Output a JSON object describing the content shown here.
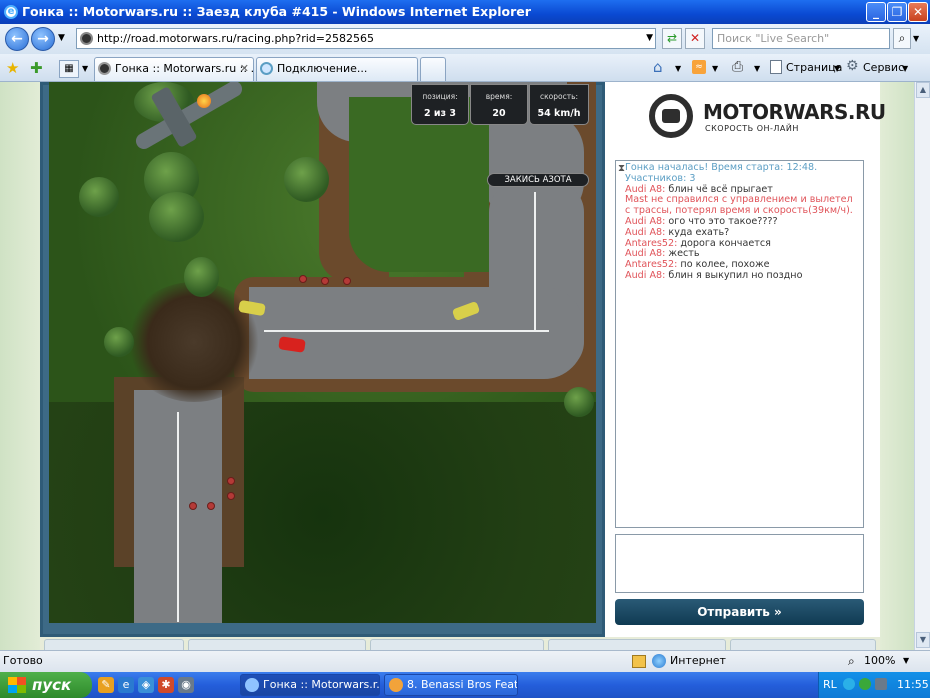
{
  "window": {
    "title": "Гонка :: Motorwars.ru :: Заезд клуба #415 - Windows Internet Explorer",
    "url": "http://road.motorwars.ru/racing.php?rid=2582565",
    "search_placeholder": "Поиск \"Live Search\""
  },
  "tabs": [
    {
      "label": "Гонка :: Motorwars.ru :: ..."
    },
    {
      "label": "Подключение..."
    }
  ],
  "toolbar": {
    "page_label": "Страница",
    "service_label": "Сервис"
  },
  "hud": {
    "position_label": "позиция:",
    "position_value": "2 из 3",
    "time_label": "время:",
    "time_value": "20",
    "speed_label": "скорость:",
    "speed_value": "54 km/h",
    "nitro_label": "ЗАКИСЬ АЗОТА"
  },
  "logo": {
    "name": "MOTORWARS.RU",
    "tagline": "СКОРОСТЬ ОН-ЛАЙН"
  },
  "chat": {
    "messages": [
      {
        "type": "sys",
        "nick": "",
        "text": "Гонка началась! Время старта: 12:48. Участников: 3"
      },
      {
        "type": "msg",
        "nick": "Audi A8:",
        "text": "блин чё всё прыгает"
      },
      {
        "type": "warn",
        "nick": "",
        "text": "Mast не справился с управлением и вылетел с трассы, потерял время и скорость(39км/ч)."
      },
      {
        "type": "msg",
        "nick": "Audi A8:",
        "text": "ого что это такое????"
      },
      {
        "type": "msg",
        "nick": "Audi A8:",
        "text": "куда ехать?"
      },
      {
        "type": "msg",
        "nick": "Antares52:",
        "text": "дорога кончается"
      },
      {
        "type": "msg",
        "nick": "Audi A8:",
        "text": "жесть"
      },
      {
        "type": "msg",
        "nick": "Antares52:",
        "text": "по колее, похоже"
      },
      {
        "type": "msg",
        "nick": "Audi A8:",
        "text": "блин я выкупил но поздно"
      }
    ],
    "send_label": "Отправить »"
  },
  "status": {
    "left": "Готово",
    "zone": "Интернет",
    "zoom": "100%"
  },
  "taskbar": {
    "start_label": "пуск",
    "tasks": [
      {
        "label": "Гонка :: Motorwars.r..."
      },
      {
        "label": "8. Benassi Bros Feat...."
      }
    ],
    "lang": "RL",
    "clock": "11:55"
  },
  "colors": {
    "accent": "#0a49d2",
    "chat_system": "#5b9ec4",
    "chat_warning": "#e0545a",
    "send_button": "#1c4a66"
  }
}
